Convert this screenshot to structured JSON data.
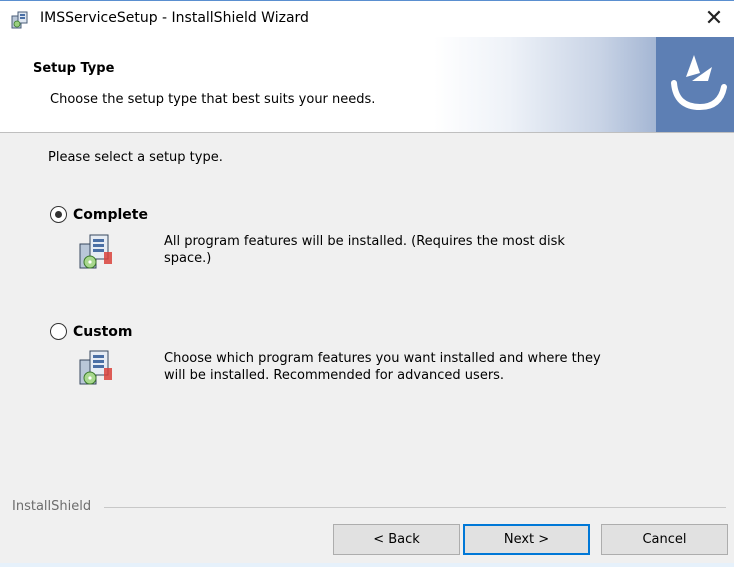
{
  "window": {
    "title": "IMSServiceSetup - InstallShield Wizard",
    "close_glyph": "✕"
  },
  "header": {
    "title": "Setup Type",
    "subtitle": "Choose the setup type that best suits your needs."
  },
  "content": {
    "prompt": "Please select a setup type.",
    "options": [
      {
        "label": "Complete",
        "description_line1": "All program features will be installed. (Requires the most disk",
        "description_line2": "space.)",
        "selected": true
      },
      {
        "label": "Custom",
        "description_line1": "Choose which program features you want installed and where they",
        "description_line2": "will be installed. Recommended for advanced users.",
        "selected": false
      }
    ]
  },
  "footer": {
    "brand": "InstallShield",
    "back_label": "< Back",
    "next_label": "Next >",
    "cancel_label": "Cancel"
  },
  "icons": {
    "title": "installer-icon",
    "option": "setup-package-icon",
    "header": "installshield-logo-icon"
  },
  "colors": {
    "accent": "#0078d7",
    "header_logo_bg": "#5d7fb4"
  }
}
